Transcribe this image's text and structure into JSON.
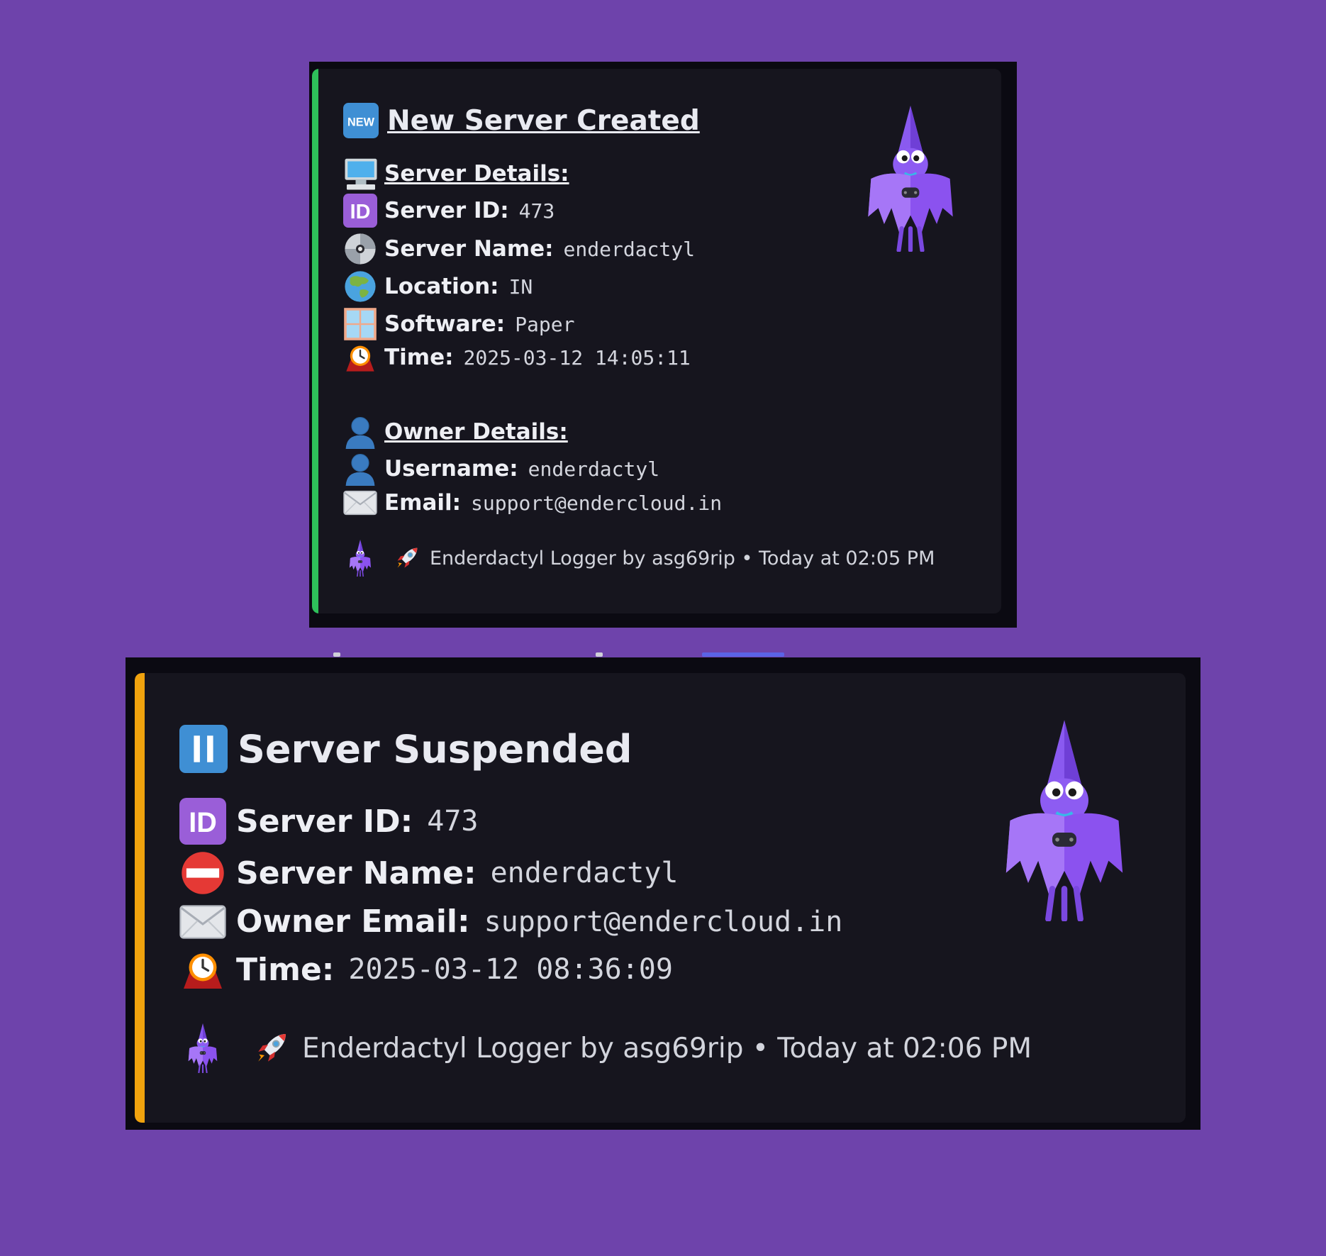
{
  "colors": {
    "background": "#6e43ab",
    "created_accent": "#2ec05a",
    "suspended_accent": "#f0a20e"
  },
  "created": {
    "title_icon": "new-button-emoji-icon",
    "title": "New Server Created",
    "server_details_icon": "desktop-computer-icon",
    "server_details_heading": "Server Details:",
    "server_id_label": "Server ID:",
    "server_id_value": "473",
    "server_name_label": "Server Name:",
    "server_name_value": "enderdactyl",
    "location_label": "Location:",
    "location_value": "IN",
    "software_label": "Software:",
    "software_value": "Paper",
    "time_label": "Time:",
    "time_value": "2025-03-12 14:05:11",
    "owner_details_icon": "bust-in-silhouette-icon",
    "owner_details_heading": "Owner Details:",
    "username_label": "Username:",
    "username_value": "enderdactyl",
    "email_label": "Email:",
    "email_value": "support@endercloud.in",
    "footer_text": "Enderdactyl Logger by asg69rip • Today at 02:05 PM",
    "thumbnail": "pterodactyl-mascot-icon"
  },
  "suspended": {
    "title_icon": "pause-button-icon",
    "title": "Server Suspended",
    "server_id_label": "Server ID:",
    "server_id_value": "473",
    "server_name_label": "Server Name:",
    "server_name_value": "enderdactyl",
    "owner_email_label": "Owner Email:",
    "owner_email_value": "support@endercloud.in",
    "time_label": "Time:",
    "time_value": "2025-03-12 08:36:09",
    "footer_text": "Enderdactyl Logger by asg69rip • Today at 02:06 PM",
    "thumbnail": "pterodactyl-mascot-icon"
  }
}
